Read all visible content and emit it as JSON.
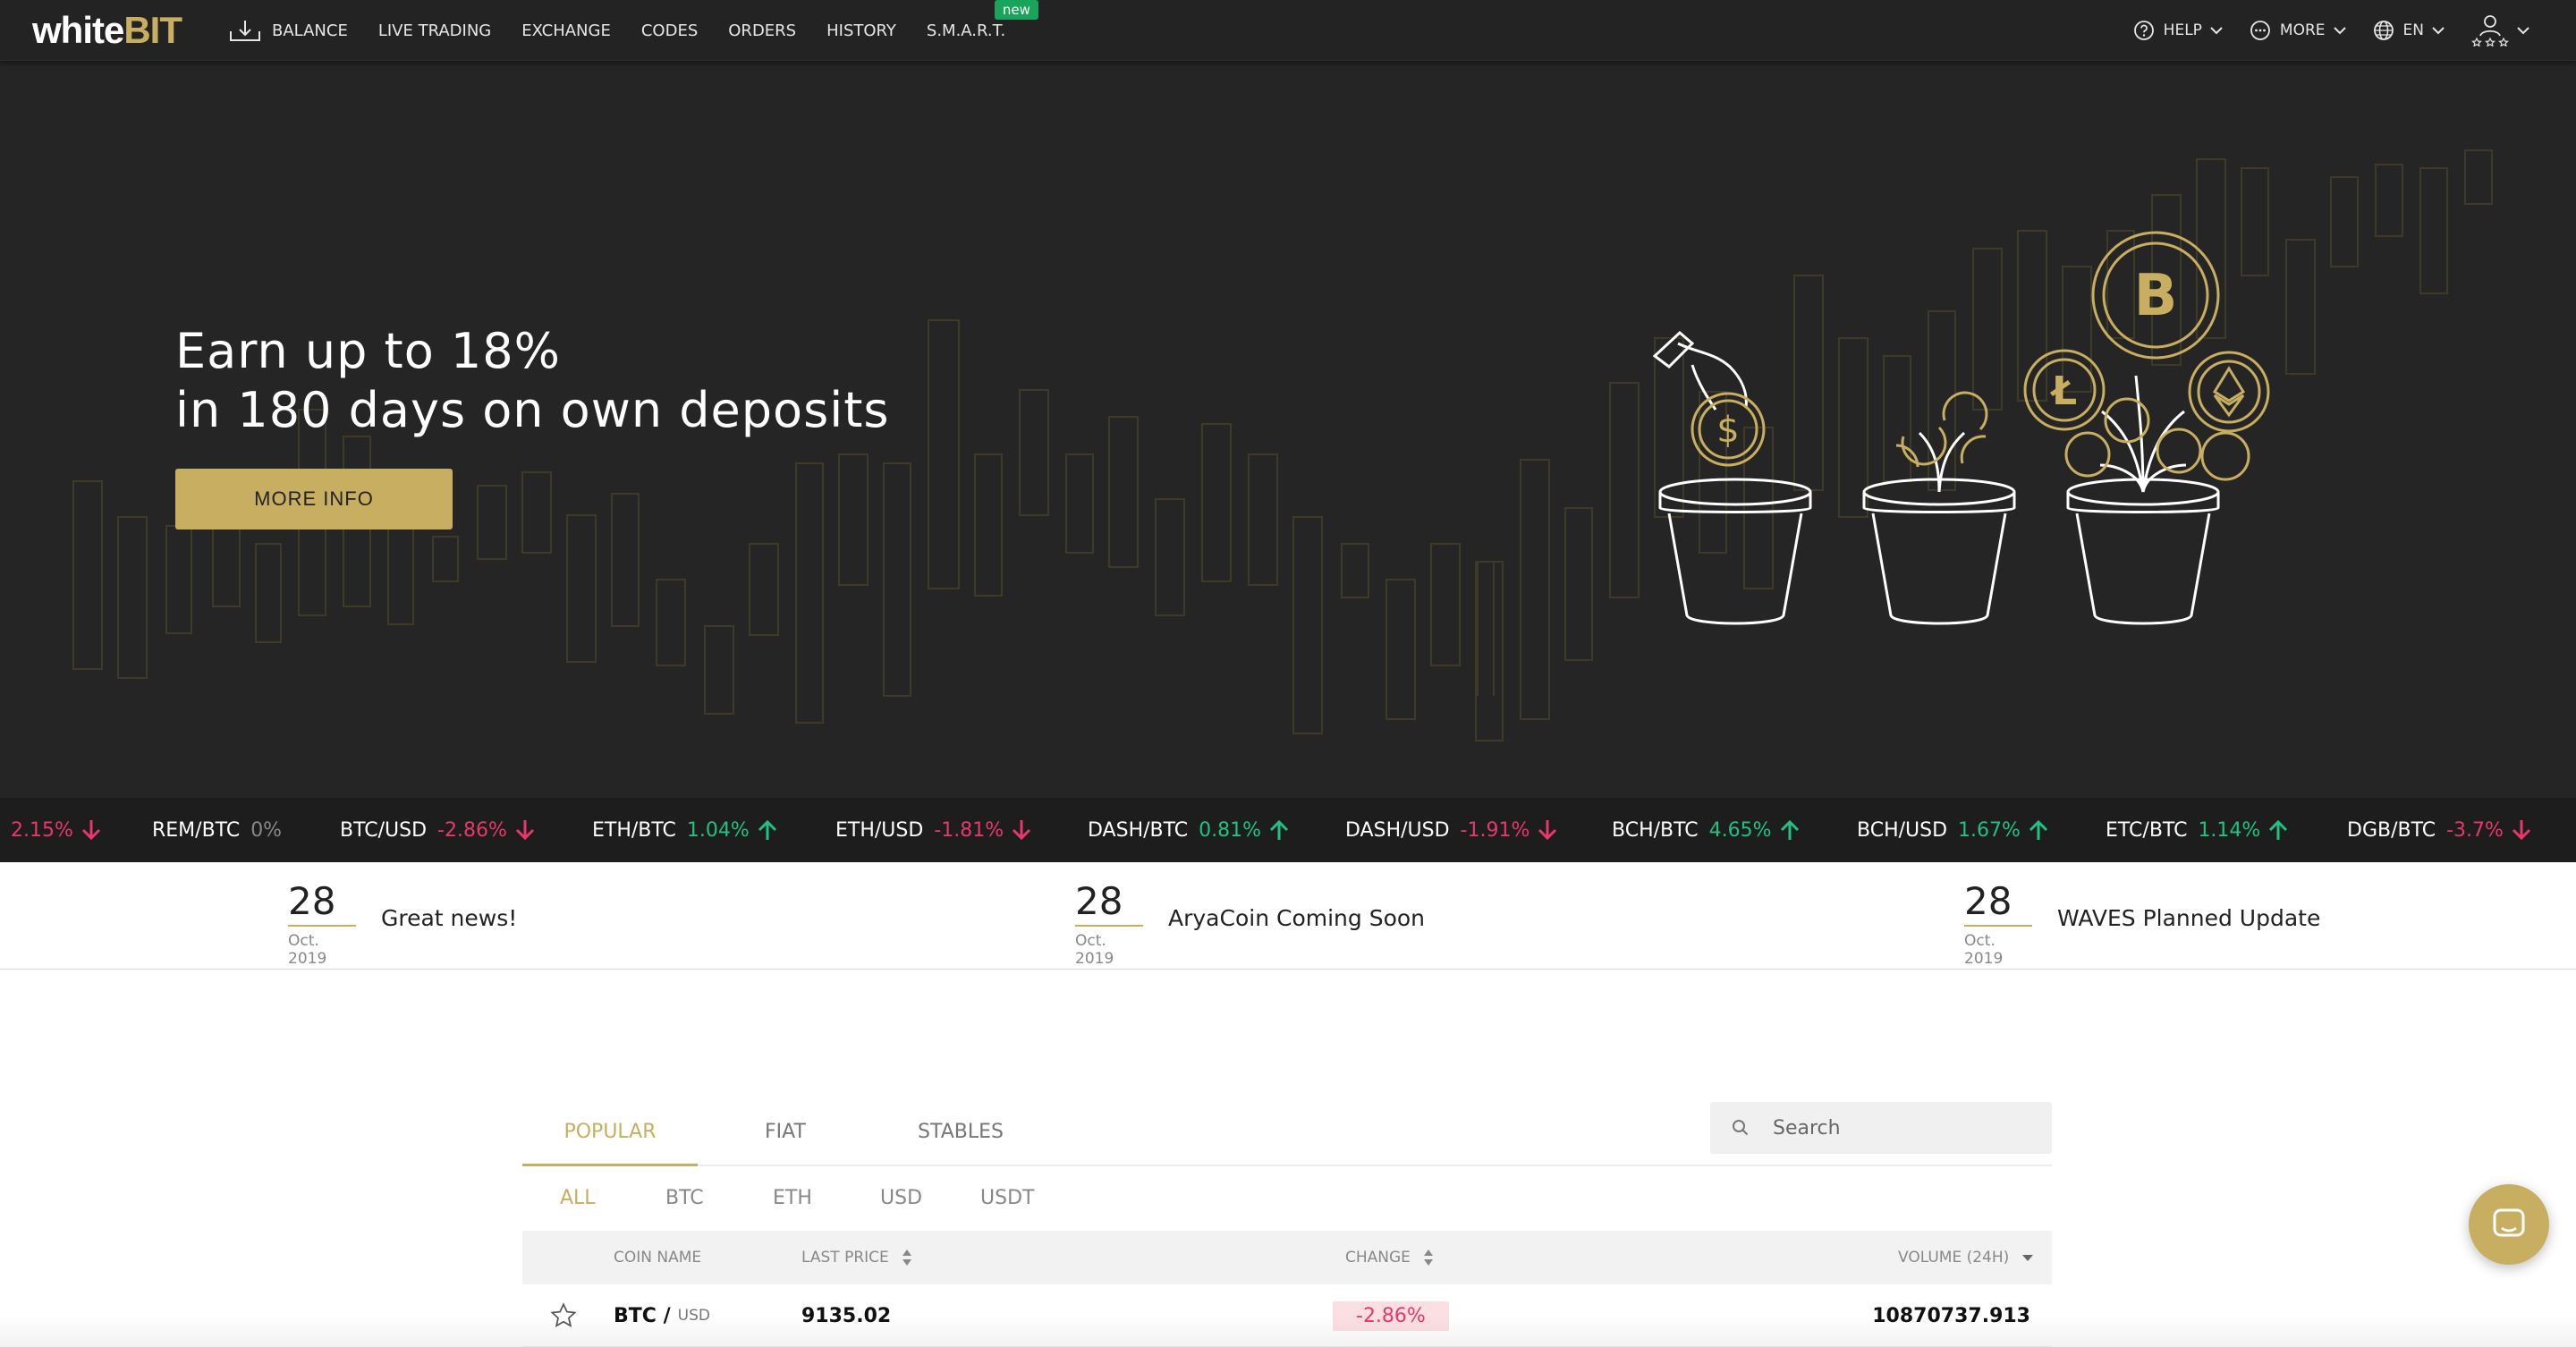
{
  "header": {
    "logo_white": "white",
    "logo_gold": "BIT",
    "nav": [
      {
        "label": "BALANCE",
        "icon": "download-icon"
      },
      {
        "label": "LIVE TRADING"
      },
      {
        "label": "EXCHANGE"
      },
      {
        "label": "CODES"
      },
      {
        "label": "ORDERS"
      },
      {
        "label": "HISTORY"
      },
      {
        "label": "S.M.A.R.T.",
        "badge": "new"
      }
    ],
    "right": {
      "help": "HELP",
      "more": "MORE",
      "lang": "EN"
    }
  },
  "hero": {
    "line1": "Earn up to 18%",
    "line2": "in 180 days on own deposits",
    "button": "MORE INFO"
  },
  "ticker": [
    {
      "pair": "",
      "change": "2.15%",
      "dir": "down"
    },
    {
      "pair": "REM/BTC",
      "change": "0%",
      "dir": "none"
    },
    {
      "pair": "BTC/USD",
      "change": "-2.86%",
      "dir": "down"
    },
    {
      "pair": "ETH/BTC",
      "change": "1.04%",
      "dir": "up"
    },
    {
      "pair": "ETH/USD",
      "change": "-1.81%",
      "dir": "down"
    },
    {
      "pair": "DASH/BTC",
      "change": "0.81%",
      "dir": "up"
    },
    {
      "pair": "DASH/USD",
      "change": "-1.91%",
      "dir": "down"
    },
    {
      "pair": "BCH/BTC",
      "change": "4.65%",
      "dir": "up"
    },
    {
      "pair": "BCH/USD",
      "change": "1.67%",
      "dir": "up"
    },
    {
      "pair": "ETC/BTC",
      "change": "1.14%",
      "dir": "up"
    },
    {
      "pair": "DGB/BTC",
      "change": "-3.7%",
      "dir": "down"
    }
  ],
  "news": [
    {
      "day": "28",
      "month": "Oct. 2019",
      "title": "Great news!"
    },
    {
      "day": "28",
      "month": "Oct. 2019",
      "title": "AryaCoin Coming Soon"
    },
    {
      "day": "28",
      "month": "Oct. 2019",
      "title": "WAVES Planned Update"
    }
  ],
  "markets": {
    "tabs": [
      "POPULAR",
      "FIAT",
      "STABLES"
    ],
    "subtabs": [
      "ALL",
      "BTC",
      "ETH",
      "USD",
      "USDT"
    ],
    "search_placeholder": "Search",
    "columns": {
      "coin": "COIN NAME",
      "price": "LAST PRICE",
      "change": "CHANGE",
      "volume": "VOLUME (24H)"
    },
    "rows": [
      {
        "base": "BTC /",
        "quote": "USD",
        "price": "9135.02",
        "change": "-2.86%",
        "volume": "10870737.913"
      }
    ]
  },
  "colors": {
    "brand_gold": "#c8ae60",
    "dark_bg": "#252525",
    "negative": "#e7386b",
    "positive": "#1fc283"
  }
}
